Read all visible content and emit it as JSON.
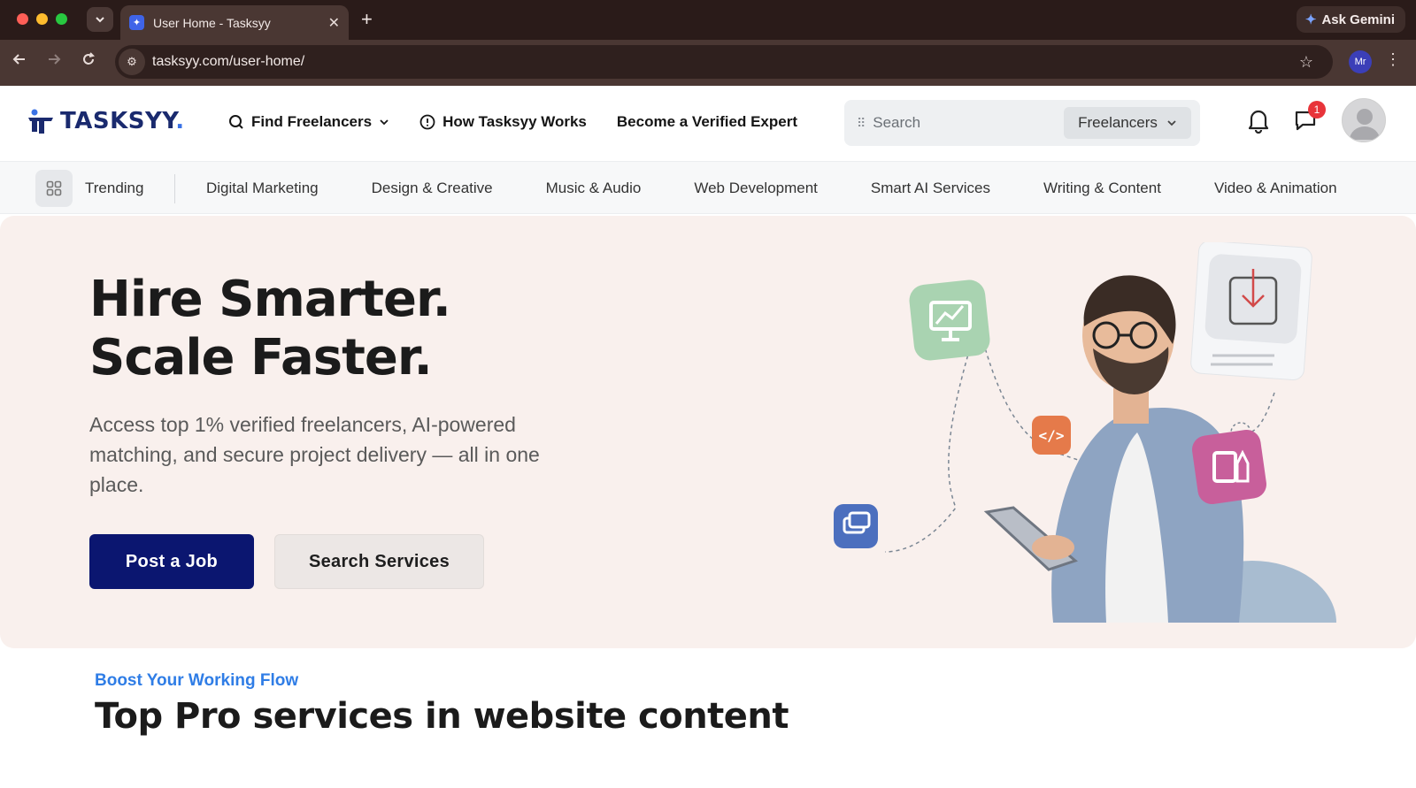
{
  "browser": {
    "tab_title": "User Home - Tasksyy",
    "url": "tasksyy.com/user-home/",
    "gemini_label": "Ask Gemini",
    "profile_initials": "Mr"
  },
  "header": {
    "logo_text": "TASKSYY",
    "logo_dot": ".",
    "nav": {
      "find_freelancers": "Find Freelancers",
      "how_it_works": "How Tasksyy Works",
      "become_expert": "Become a Verified Expert"
    },
    "search": {
      "placeholder": "Search",
      "scope": "Freelancers"
    },
    "messages_badge": "1"
  },
  "categories": {
    "trending": "Trending",
    "items": [
      "Digital Marketing",
      "Design & Creative",
      "Music & Audio",
      "Web Development",
      "Smart AI Services",
      "Writing & Content",
      "Video & Animation"
    ]
  },
  "hero": {
    "title": "Hire Smarter. Scale Faster.",
    "subtitle": "Access top 1% verified freelancers, AI-powered matching, and secure project delivery — all in one place.",
    "primary_button": "Post a Job",
    "secondary_button": "Search Services"
  },
  "section": {
    "eyebrow": "Boost Your Working Flow",
    "title": "Top Pro services in website content"
  },
  "colors": {
    "brand_navy": "#0b1670",
    "accent_blue": "#2f7de6",
    "hero_bg": "#f9f0ed",
    "badge_red": "#e8343a"
  }
}
